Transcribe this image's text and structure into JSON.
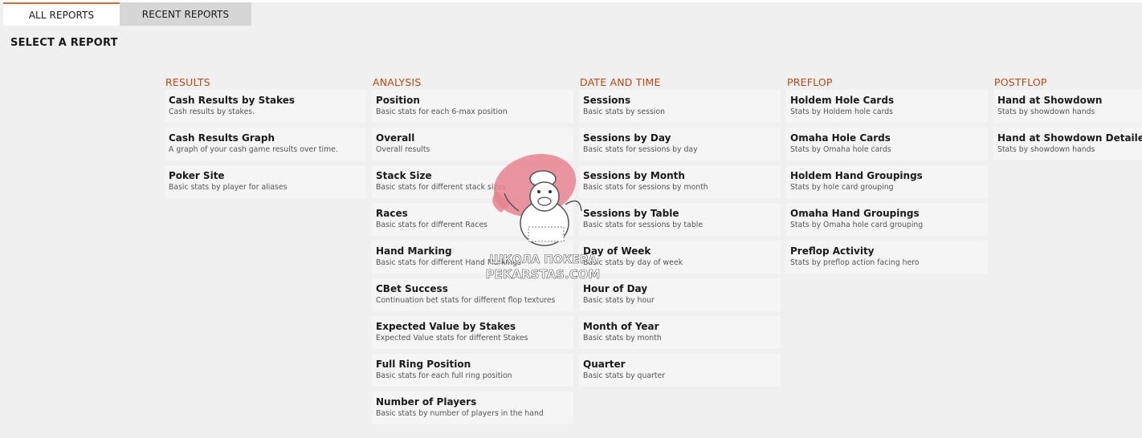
{
  "tabs": {
    "all": "ALL REPORTS",
    "recent": "RECENT REPORTS"
  },
  "heading": "SELECT A REPORT",
  "columns": [
    {
      "title": "RESULTS",
      "reports": [
        {
          "title": "Cash Results by Stakes",
          "desc": "Cash results by stakes."
        },
        {
          "title": "Cash Results Graph",
          "desc": "A graph of your cash game results over time."
        },
        {
          "title": "Poker Site",
          "desc": "Basic stats by player for aliases"
        }
      ]
    },
    {
      "title": "ANALYSIS",
      "reports": [
        {
          "title": "Position",
          "desc": "Basic stats for each 6-max position"
        },
        {
          "title": "Overall",
          "desc": "Overall results"
        },
        {
          "title": "Stack Size",
          "desc": "Basic stats for different stack sizes"
        },
        {
          "title": "Races",
          "desc": "Basic stats for different Races"
        },
        {
          "title": "Hand Marking",
          "desc": "Basic stats for different Hand Markings"
        },
        {
          "title": "CBet Success",
          "desc": "Continuation bet stats for different flop textures"
        },
        {
          "title": "Expected Value by Stakes",
          "desc": "Expected Value stats for different Stakes"
        },
        {
          "title": "Full Ring Position",
          "desc": "Basic stats for each full ring position"
        },
        {
          "title": "Number of Players",
          "desc": "Basic stats by number of players in the hand"
        }
      ]
    },
    {
      "title": "DATE AND TIME",
      "reports": [
        {
          "title": "Sessions",
          "desc": "Basic stats by session"
        },
        {
          "title": "Sessions by Day",
          "desc": "Basic stats for sessions by day"
        },
        {
          "title": "Sessions by Month",
          "desc": "Basic stats for sessions by month"
        },
        {
          "title": "Sessions by Table",
          "desc": "Basic stats for sessions by table"
        },
        {
          "title": "Day of Week",
          "desc": "Basic stats by day of week"
        },
        {
          "title": "Hour of Day",
          "desc": "Basic stats by hour"
        },
        {
          "title": "Month of Year",
          "desc": "Basic stats by month"
        },
        {
          "title": "Quarter",
          "desc": "Basic stats by quarter"
        }
      ]
    },
    {
      "title": "PREFLOP",
      "reports": [
        {
          "title": "Holdem Hole Cards",
          "desc": "Stats by Holdem hole cards"
        },
        {
          "title": "Omaha Hole Cards",
          "desc": "Stats by Omaha hole cards"
        },
        {
          "title": "Holdem Hand Groupings",
          "desc": "Stats by hole card grouping"
        },
        {
          "title": "Omaha Hand Groupings",
          "desc": "Stats by Omaha hole card grouping"
        },
        {
          "title": "Preflop Activity",
          "desc": "Stats by preflop action facing hero"
        }
      ]
    },
    {
      "title": "POSTFLOP",
      "reports": [
        {
          "title": "Hand at Showdown",
          "desc": "Stats by showdown hands"
        },
        {
          "title": "Hand at Showdown Detailed",
          "desc": "Stats by showdown hands"
        }
      ]
    }
  ],
  "watermark": {
    "line1": "ШКОЛА ПОКЕРА",
    "line2": "PEKARSTAS.COM"
  }
}
